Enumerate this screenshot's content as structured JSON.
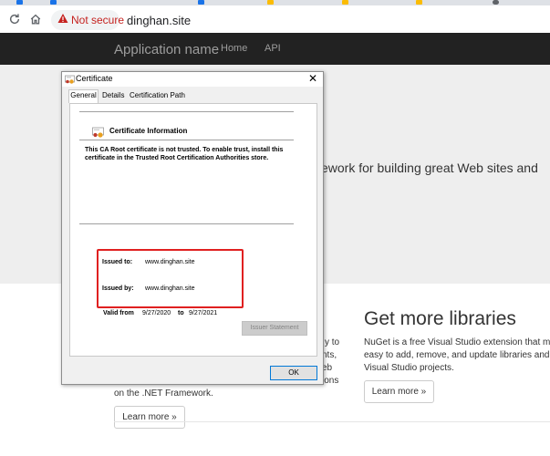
{
  "browser": {
    "security_label": "Not secure",
    "url": "dinghan.site",
    "tab_colors": [
      "#1a73e8",
      "#1a73e8",
      "#1a73e8",
      "#fbbc04",
      "#fbbc04",
      "#fbbc04",
      "#5f6368"
    ]
  },
  "site": {
    "brand": "Application name",
    "nav": [
      "Home",
      "API"
    ],
    "lead_text": "ework for building great Web sites and",
    "left_column": {
      "line1": "y to",
      "line2": "nts,",
      "line3": "eb",
      "line4": "ions",
      "last_line": "on the .NET Framework.",
      "button": "Learn more »"
    },
    "right_column": {
      "heading": "Get more libraries",
      "line1": "NuGet is a free Visual Studio extension that ma",
      "line2": "easy to add, remove, and update libraries and",
      "line3": "Visual Studio projects.",
      "button": "Learn more »"
    }
  },
  "dialog": {
    "title": "Certificate",
    "close_glyph": "✕",
    "tabs": [
      "General",
      "Details",
      "Certification Path"
    ],
    "info_title": "Certificate Information",
    "warning": "This CA Root certificate is not trusted. To enable trust, install this certificate in the Trusted Root Certification Authorities store.",
    "issued_to_label": "Issued to:",
    "issued_to_value": "www.dinghan.site",
    "issued_by_label": "Issued by:",
    "issued_by_value": "www.dinghan.site",
    "valid_from_label": "Valid from",
    "valid_from_value": "9/27/2020",
    "valid_to_label": "to",
    "valid_to_value": "9/27/2021",
    "issuer_button": "Issuer Statement",
    "ok_button": "OK"
  }
}
